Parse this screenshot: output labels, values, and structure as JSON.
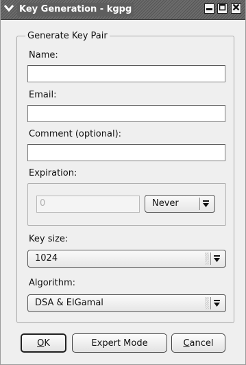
{
  "window": {
    "title": "Key Generation - kgpg"
  },
  "group": {
    "title": "Generate Key Pair"
  },
  "fields": {
    "name_label": "Name:",
    "name_value": "",
    "email_label": "Email:",
    "email_value": "",
    "comment_label": "Comment (optional):",
    "comment_value": ""
  },
  "expiration": {
    "label": "Expiration:",
    "number_value": "0",
    "unit_selected": "Never"
  },
  "key_size": {
    "label": "Key size:",
    "selected": "1024"
  },
  "algorithm": {
    "label": "Algorithm:",
    "selected": "DSA & ElGamal"
  },
  "buttons": {
    "ok_mnemonic": "O",
    "ok_rest": "K",
    "expert": "Expert Mode",
    "cancel_mnemonic": "C",
    "cancel_rest": "ancel"
  },
  "icons": {
    "window_menu": "chevron-down-icon",
    "minimize": "minimize-icon",
    "maximize": "maximize-icon",
    "close": "close-icon",
    "combo_arrow": "arrow-down-icon"
  }
}
